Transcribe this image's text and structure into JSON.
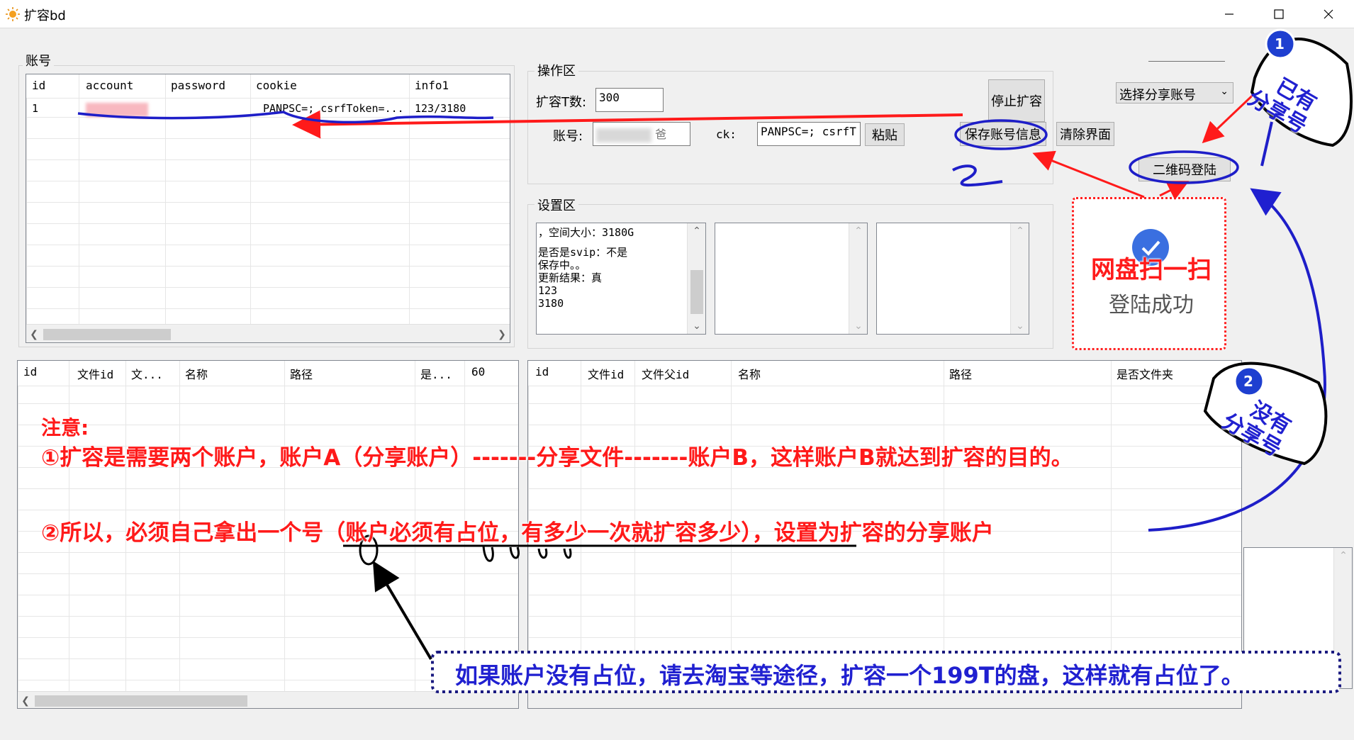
{
  "window": {
    "title": "扩容bd"
  },
  "account_group": {
    "label": "账号",
    "columns": [
      "id",
      "account",
      "password",
      "cookie",
      "info1"
    ],
    "rows": [
      {
        "id": "1",
        "account": "",
        "password": "",
        "cookie": "PANPSC=; csrfToken=...",
        "info1": "123/3180"
      }
    ]
  },
  "operation_group": {
    "label": "操作区",
    "tb_label": "扩容T数:",
    "tb_value": "300",
    "account_label": "账号:",
    "account_value": "TR...爸",
    "ck_label": "ck:",
    "ck_value": "PANPSC=; csrfT",
    "paste_button": "粘贴",
    "stop_button": "停止扩容",
    "save_button": "保存账号信息",
    "clear_button": "清除界面",
    "share_select": "选择分享账号",
    "qr_button": "二维码登陆"
  },
  "settings_group": {
    "label": "设置区",
    "log_lines": [
      "，空间大小：3180G",
      "",
      "是否是svip：不是",
      "保存中。。",
      "更新结果：真",
      "123",
      "3180"
    ]
  },
  "left_files": {
    "columns": [
      "id",
      "文件id",
      "文...",
      "名称",
      "路径",
      "是...",
      "60"
    ]
  },
  "right_files": {
    "columns": [
      "id",
      "文件id",
      "文件父id",
      "名称",
      "路径",
      "是否文件夹"
    ]
  },
  "annotations": {
    "badge1": "1",
    "tag1_line1": "已有",
    "tag1_line2": "分享号",
    "badge2": "2",
    "tag2_line1": "没有",
    "tag2_line2": "分享号",
    "scan_line1": "网盘扫一扫",
    "scan_line2": "登陆成功",
    "note_title": "注意:",
    "note_1": "①扩容是需要两个账户，账户A（分享账户）-------分享文件-------账户B，这样账户B就达到扩容的目的。",
    "note_2": "②所以，必须自己拿出一个号（账户必须有占位，有多少一次就扩容多少），设置为扩容的分享账户",
    "note_3": "如果账户没有占位，请去淘宝等途径，扩容一个199T的盘，这样就有占位了。"
  },
  "colors": {
    "red": "#ff1a1a",
    "blue": "#1e1ec8",
    "navy": "#1a1a80"
  }
}
